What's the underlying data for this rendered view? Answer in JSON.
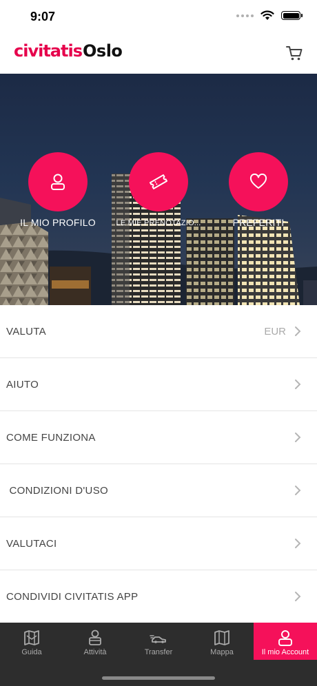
{
  "status_bar": {
    "time": "9:07"
  },
  "header": {
    "logo": "civitatis",
    "city": "Oslo",
    "cart_icon": "cart-icon"
  },
  "hero": {
    "items": [
      {
        "label": "IL MIO PROFILO",
        "icon": "user-icon"
      },
      {
        "label": "LE MIE PRENOTAZIO...",
        "icon": "ticket-icon"
      },
      {
        "label": "PREFERITI",
        "icon": "heart-icon"
      }
    ]
  },
  "menu": {
    "items": [
      {
        "label": "VALUTA",
        "value": "EUR"
      },
      {
        "label": "AIUTO"
      },
      {
        "label": "COME FUNZIONA"
      },
      {
        "label": " CONDIZIONI D'USO"
      },
      {
        "label": "VALUTACI"
      },
      {
        "label": "CONDIVIDI CIVITATIS APP"
      }
    ]
  },
  "tabs": [
    {
      "label": "Guida",
      "icon": "guide-map-icon"
    },
    {
      "label": "Attività",
      "icon": "activity-person-icon"
    },
    {
      "label": "Transfer",
      "icon": "transfer-car-icon"
    },
    {
      "label": "Mappa",
      "icon": "map-icon"
    },
    {
      "label": "Il mio Account",
      "icon": "account-user-icon",
      "active": true
    }
  ],
  "colors": {
    "brand": "#f5115a",
    "logo": "#e6004c",
    "tab_bar": "#2d2d2d"
  }
}
